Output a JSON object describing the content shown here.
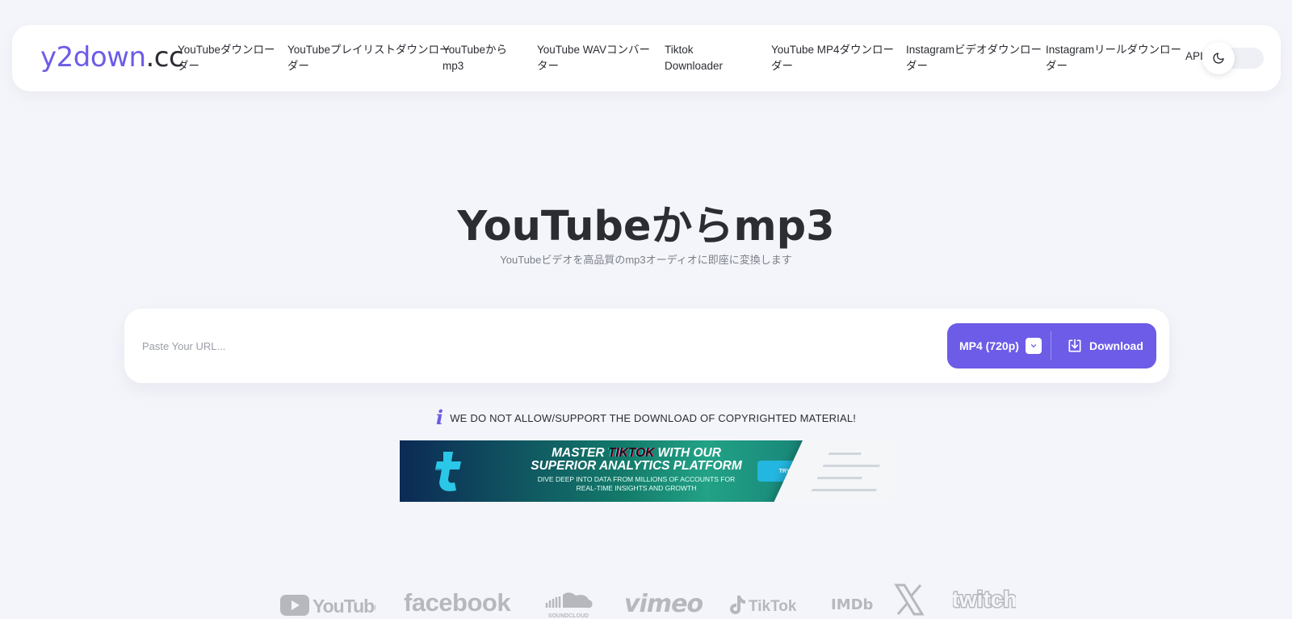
{
  "header": {
    "logo_brand": "y2down",
    "logo_tld": ".cc",
    "nav": [
      {
        "line1": "YouTubeダウンロー",
        "line2": "ダー"
      },
      {
        "line1": "YouTubeプレイリストダウンロー",
        "line2": "ダー"
      },
      {
        "line1": "YouTubeから",
        "line2": "mp3"
      },
      {
        "line1": "YouTube WAVコンバー",
        "line2": "ター"
      },
      {
        "line1": "Tiktok",
        "line2": "Downloader"
      },
      {
        "line1": "YouTube MP4ダウンロー",
        "line2": "ダー"
      },
      {
        "line1": "Instagramビデオダウンロー",
        "line2": "ダー"
      },
      {
        "line1": "Instagramリールダウンロー",
        "line2": "ダー"
      }
    ],
    "api_label": "API",
    "theme_icon": "moon-icon"
  },
  "hero": {
    "title": "YouTubeからmp3",
    "subtitle": "YouTubeビデオを高品質のmp3オーディオに即座に変換します"
  },
  "search": {
    "placeholder": "Paste Your URL...",
    "value": "",
    "format_selected": "MP4 (720p)",
    "download_label": "Download"
  },
  "notice": {
    "icon": "i",
    "text": "WE DO NOT ALLOW/SUPPORT THE DOWNLOAD OF COPYRIGHTED MATERIAL!"
  },
  "ad": {
    "line1_pre": "MASTER ",
    "line1_brand": "TIKTOK",
    "line1_post": " WITH OUR",
    "line2": "SUPERIOR ANALYTICS PLATFORM",
    "line3": "DIVE DEEP INTO DATA FROM MILLIONS OF ACCOUNTS FOR",
    "line4": "REAL-TIME INSIGHTS AND GROWTH",
    "cta": "TRY NOW"
  },
  "platforms": [
    "YouTube",
    "facebook",
    "SOUNDCLOUD",
    "vimeo",
    "TikTok",
    "IMDb",
    "X",
    "twitch"
  ],
  "colors": {
    "accent": "#6c5ce7",
    "background": "#f4f5fa",
    "text": "#2b2d33"
  }
}
